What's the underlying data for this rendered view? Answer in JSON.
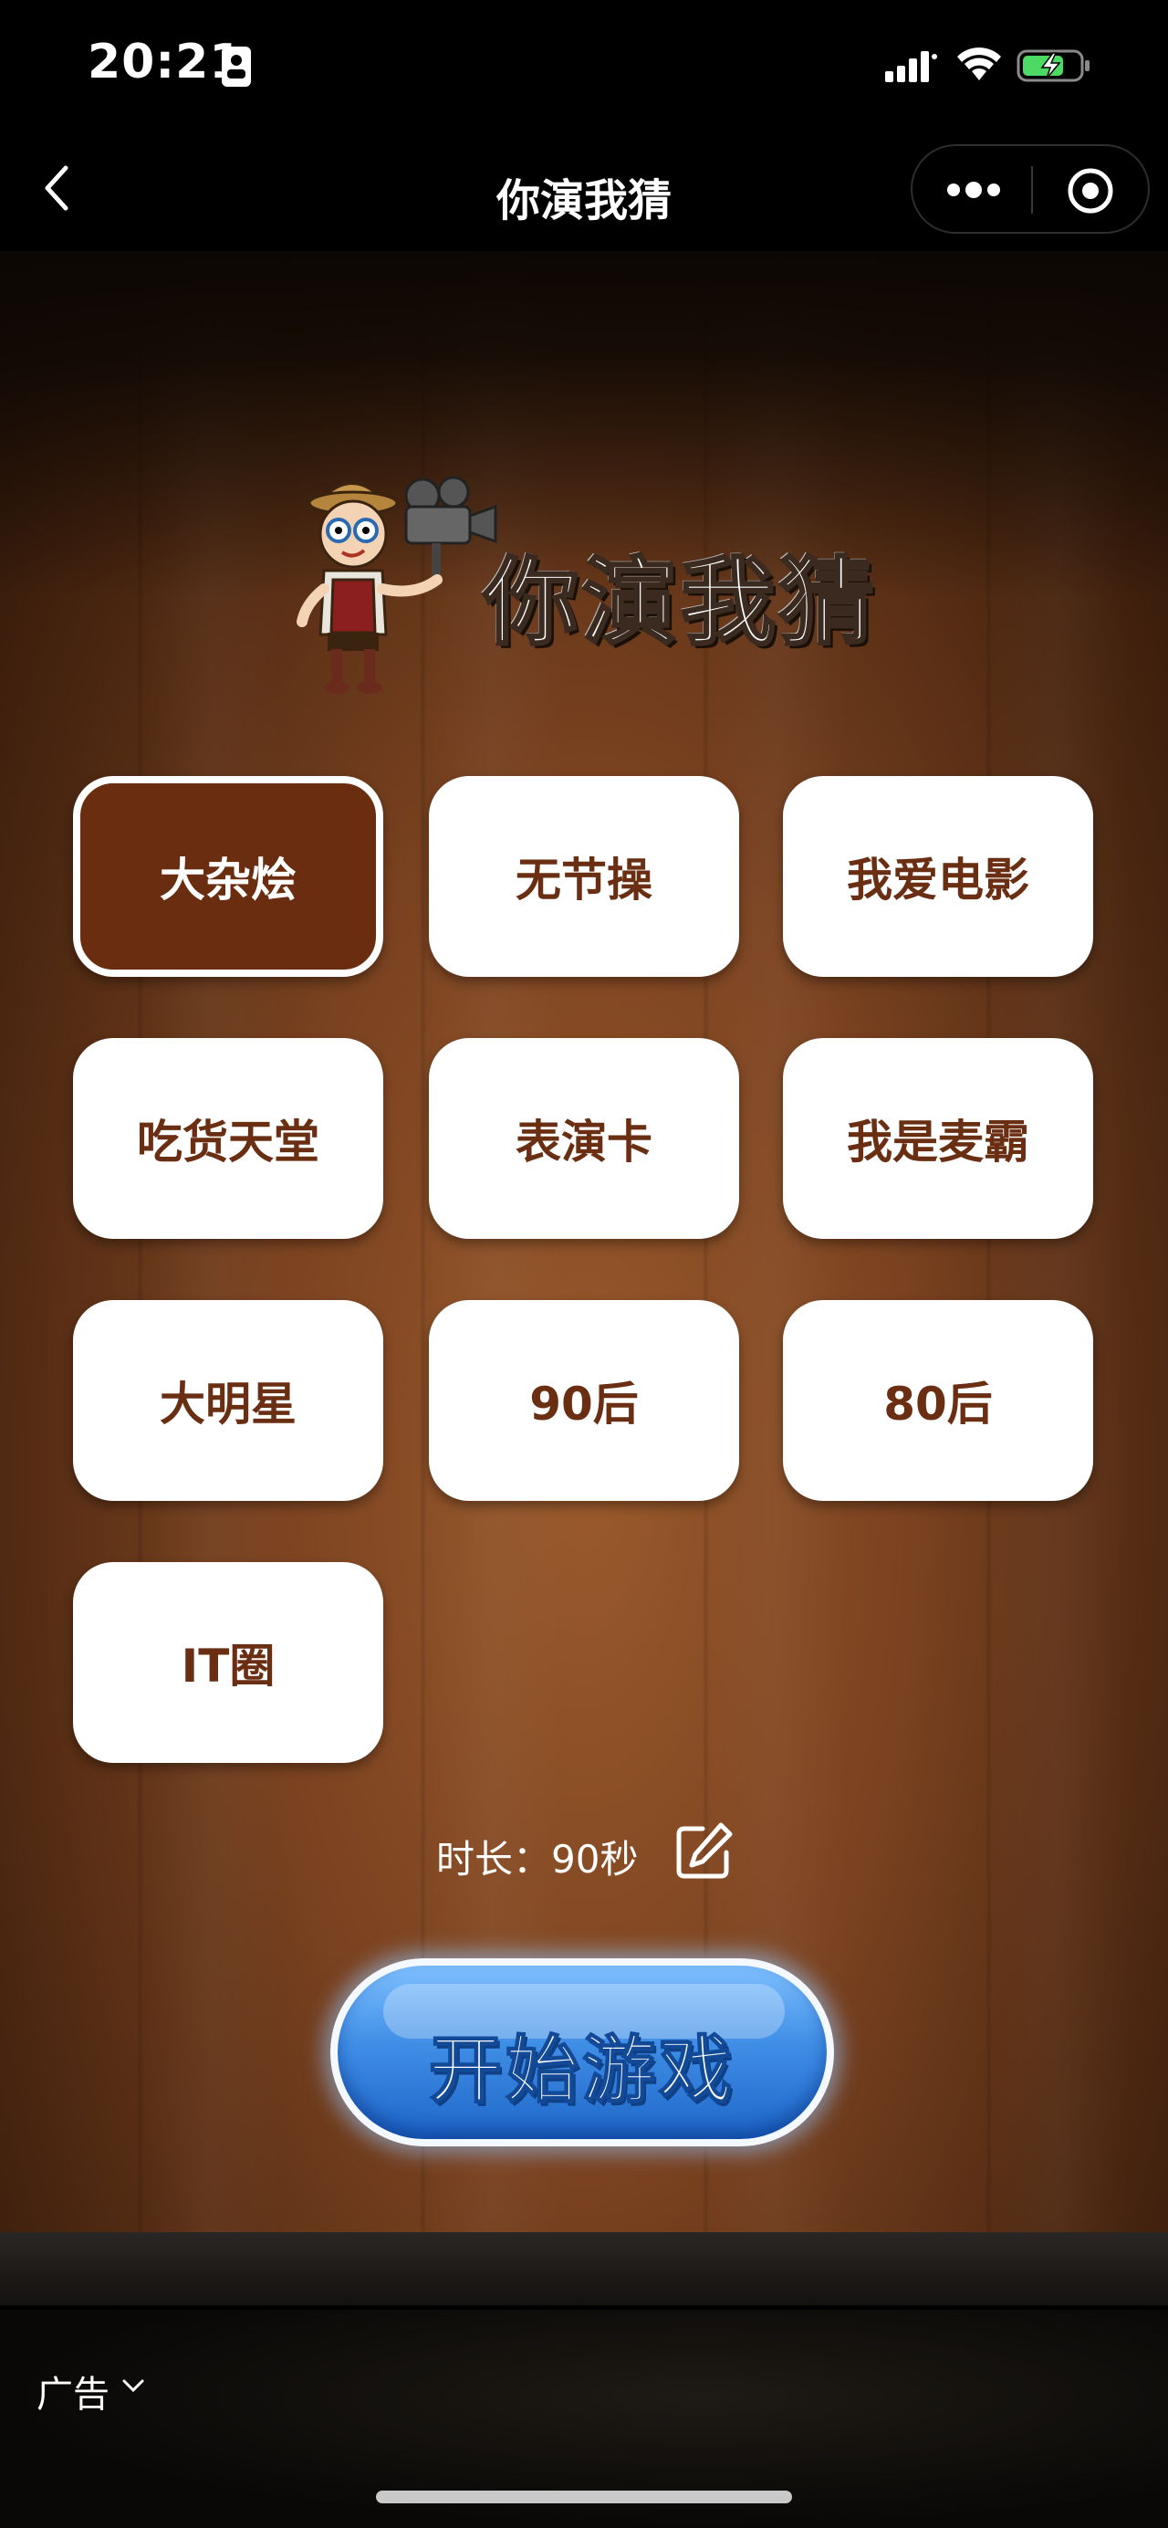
{
  "status_bar": {
    "time": "20:21",
    "icons": [
      "id-card-icon",
      "signal-icon",
      "wifi-icon",
      "battery-charging-icon"
    ]
  },
  "nav": {
    "title": "你演我猜",
    "back_icon": "chevron-left-icon",
    "more_icon": "more-dots-icon",
    "close_icon": "target-circle-icon"
  },
  "logo": {
    "text": "你演我猜",
    "mascot": "cartoon-director-mascot"
  },
  "categories": [
    {
      "label": "大杂烩",
      "selected": true
    },
    {
      "label": "无节操",
      "selected": false
    },
    {
      "label": "我爱电影",
      "selected": false
    },
    {
      "label": "吃货天堂",
      "selected": false
    },
    {
      "label": "表演卡",
      "selected": false
    },
    {
      "label": "我是麦霸",
      "selected": false
    },
    {
      "label": "大明星",
      "selected": false
    },
    {
      "label": "90后",
      "selected": false
    },
    {
      "label": "80后",
      "selected": false
    },
    {
      "label": "IT圈",
      "selected": false
    }
  ],
  "duration": {
    "text": "时长：90秒",
    "edit_icon": "edit-pencil-icon"
  },
  "start_button": {
    "label": "开始游戏"
  },
  "ad": {
    "label": "广告"
  },
  "colors": {
    "category_text": "#6a2e12",
    "selected_bg": "#6a2d0f",
    "start_button": "#3f8ee6"
  }
}
